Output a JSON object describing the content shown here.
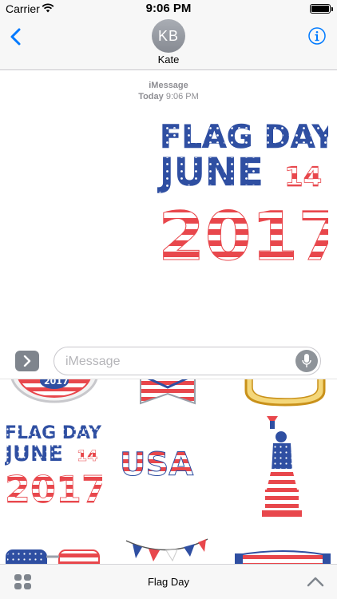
{
  "status_bar": {
    "carrier": "Carrier",
    "time": "9:06 PM"
  },
  "header": {
    "contact_initials": "KB",
    "contact_name": "Kate"
  },
  "conversation": {
    "service_label": "iMessage",
    "timestamp_day": "Today",
    "timestamp_time": "9:06 PM",
    "sticker": {
      "line1": "FLAG DAY",
      "line2": "JUNE",
      "day": "14",
      "year": "2017"
    }
  },
  "composer": {
    "placeholder": "iMessage"
  },
  "drawer": {
    "stickers": [
      {
        "kind": "badge",
        "text": "2017"
      },
      {
        "kind": "ribbon"
      },
      {
        "kind": "frame"
      },
      {
        "kind": "flag-day",
        "line1": "FLAG DAY",
        "line2": "JUNE",
        "day": "14",
        "year": "2017"
      },
      {
        "kind": "usa",
        "text": "USA"
      },
      {
        "kind": "statue-of-liberty"
      },
      {
        "kind": "glasses"
      },
      {
        "kind": "bunting"
      },
      {
        "kind": "banner"
      }
    ]
  },
  "app_bar": {
    "app_name": "Flag Day"
  },
  "colors": {
    "accent": "#007aff",
    "flag_red": "#e8474c",
    "flag_blue": "#2f4fa2",
    "gray": "#8e8e93"
  }
}
